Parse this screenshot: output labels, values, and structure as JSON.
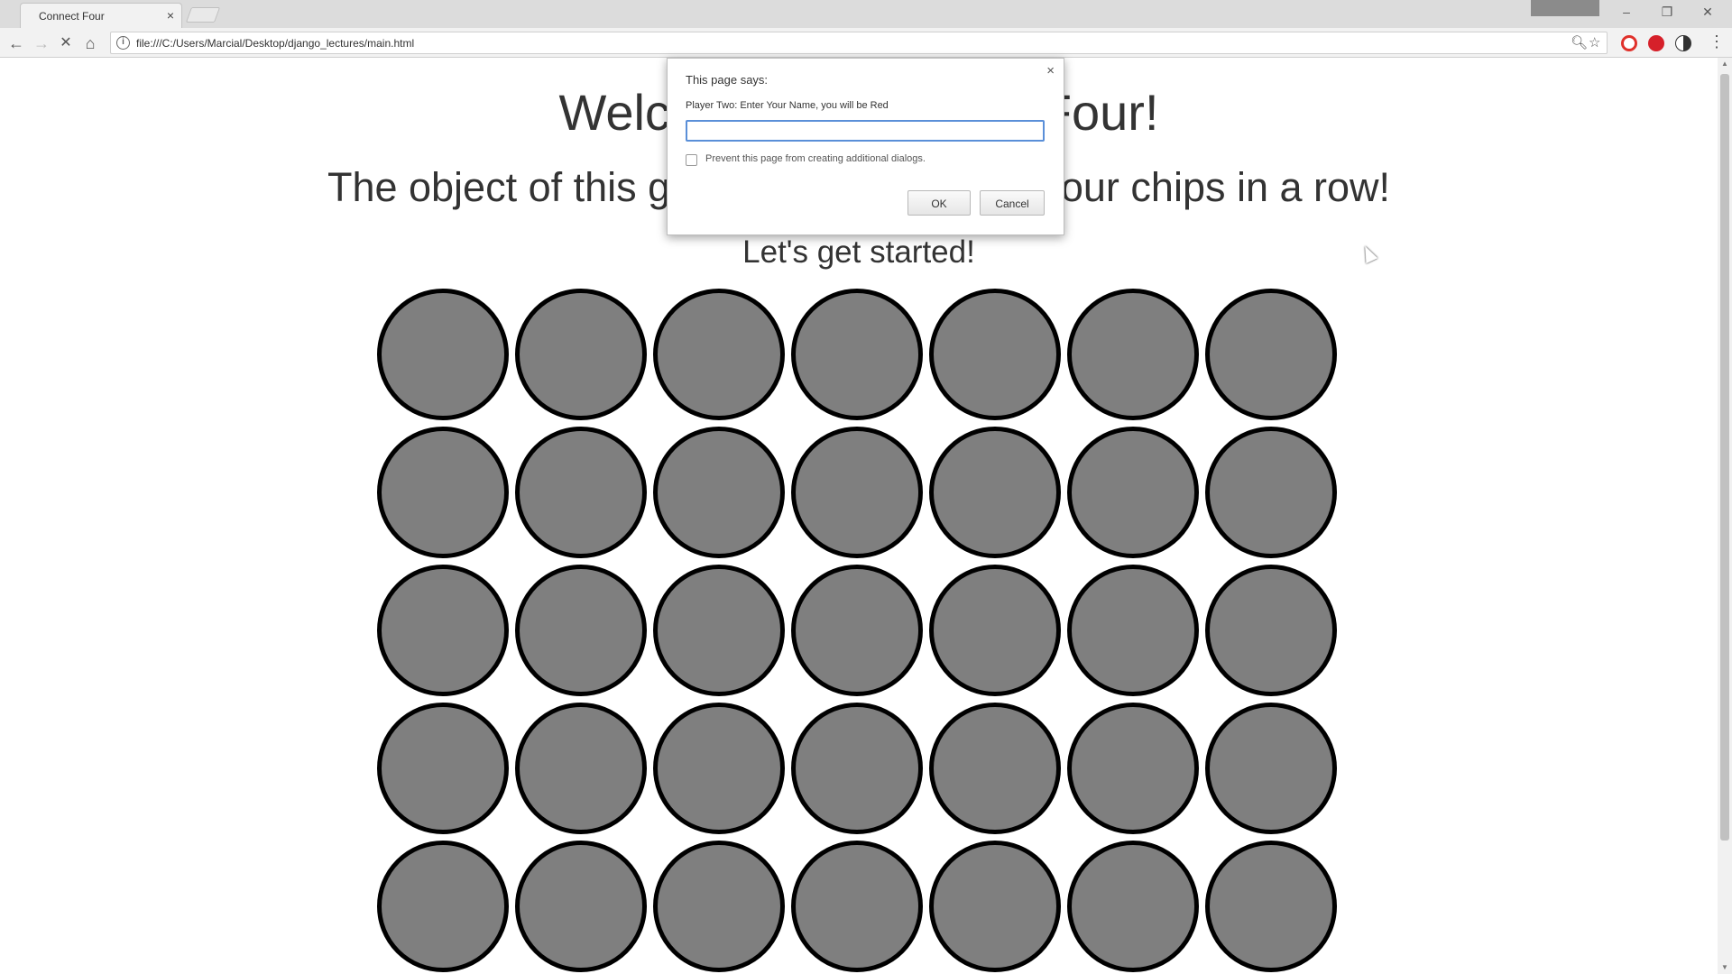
{
  "browser": {
    "tab_title": "Connect Four",
    "tab_close": "×",
    "url": "file:///C:/Users/Marcial/Desktop/django_lectures/main.html",
    "window_controls": {
      "minimize": "–",
      "restore": "❐",
      "close": "✕"
    },
    "nav": {
      "back": "←",
      "forward": "→",
      "stop": "✕",
      "home": "⌂"
    },
    "icons": {
      "info": "i",
      "zoom": "🔍︎",
      "star": "☆",
      "menu": "⋮"
    },
    "extension_colors": [
      "#e0312b",
      "#d6202a",
      "#333333"
    ]
  },
  "page": {
    "title": "Welcome to Connect Four!",
    "subtitle": "The object of this game is to get four of your chips in a row!",
    "prompt": "Let's get started!",
    "board": {
      "rows": 5,
      "cols": 7,
      "empty_color": "#7f7f7f",
      "border_color": "#000000"
    }
  },
  "dialog": {
    "close": "×",
    "title": "This page says:",
    "message": "Player Two: Enter Your Name, you will be Red",
    "input_value": "",
    "prevent_label": "Prevent this page from creating additional dialogs.",
    "prevent_checked": false,
    "ok_label": "OK",
    "cancel_label": "Cancel"
  },
  "scrollbar": {
    "up": "▲",
    "down": "▼"
  }
}
